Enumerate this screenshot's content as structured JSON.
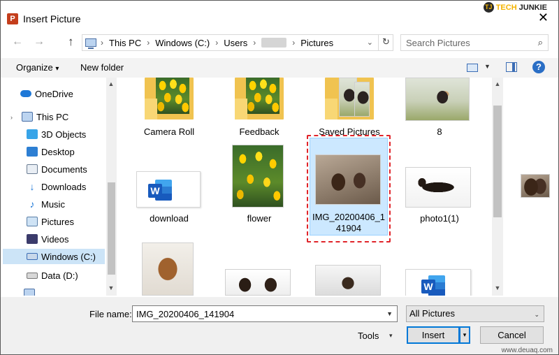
{
  "window": {
    "title": "Insert Picture",
    "app_icon": "P",
    "close_glyph": "✕"
  },
  "watermark_top": {
    "badge": "TJ",
    "tech": "TECH",
    "junkie": "JUNKIE"
  },
  "address_bar": {
    "crumbs": [
      "This PC",
      "Windows (C:)",
      "Users",
      "Pictures"
    ],
    "separator": "›",
    "chevron": "⌄"
  },
  "search": {
    "placeholder": "Search Pictures",
    "icon": "search-icon"
  },
  "command_bar": {
    "organize_label": "Organize",
    "organize_caret": "▾",
    "new_folder_label": "New folder",
    "help_glyph": "?"
  },
  "nav_pane": {
    "items": [
      {
        "label": "OneDrive",
        "icon": "cloud-icon"
      },
      {
        "label": "This PC",
        "icon": "computer-icon"
      },
      {
        "label": "3D Objects",
        "icon": "cube-icon"
      },
      {
        "label": "Desktop",
        "icon": "desktop-icon"
      },
      {
        "label": "Documents",
        "icon": "document-icon"
      },
      {
        "label": "Downloads",
        "icon": "download-icon"
      },
      {
        "label": "Music",
        "icon": "music-icon"
      },
      {
        "label": "Pictures",
        "icon": "pictures-icon"
      },
      {
        "label": "Videos",
        "icon": "video-icon"
      },
      {
        "label": "Windows (C:)",
        "icon": "drive-icon",
        "selected": true
      },
      {
        "label": "Data (D:)",
        "icon": "drive-icon"
      }
    ]
  },
  "files": [
    {
      "label": "Camera Roll",
      "kind": "folder"
    },
    {
      "label": "Feedback",
      "kind": "folder"
    },
    {
      "label": "Saved Pictures",
      "kind": "folder"
    },
    {
      "label": "8",
      "kind": "image"
    },
    {
      "label": "download",
      "kind": "word"
    },
    {
      "label": "flower",
      "kind": "image"
    },
    {
      "label": "IMG_20200406_141904",
      "label_line1": "IMG_20200406_1",
      "label_line2": "41904",
      "kind": "image",
      "selected": true
    },
    {
      "label": "photo1(1)",
      "kind": "image"
    }
  ],
  "bottom": {
    "file_name_label": "File name:",
    "file_name_value": "IMG_20200406_141904",
    "filter_value": "All Pictures",
    "tools_label": "Tools",
    "insert_label": "Insert",
    "cancel_label": "Cancel",
    "caret": "▾"
  },
  "watermark_bottom": "www.deuaq.com",
  "colors": {
    "selection_bg": "#cce8ff",
    "highlight_dash": "#e0242a",
    "accent": "#0078d7"
  }
}
